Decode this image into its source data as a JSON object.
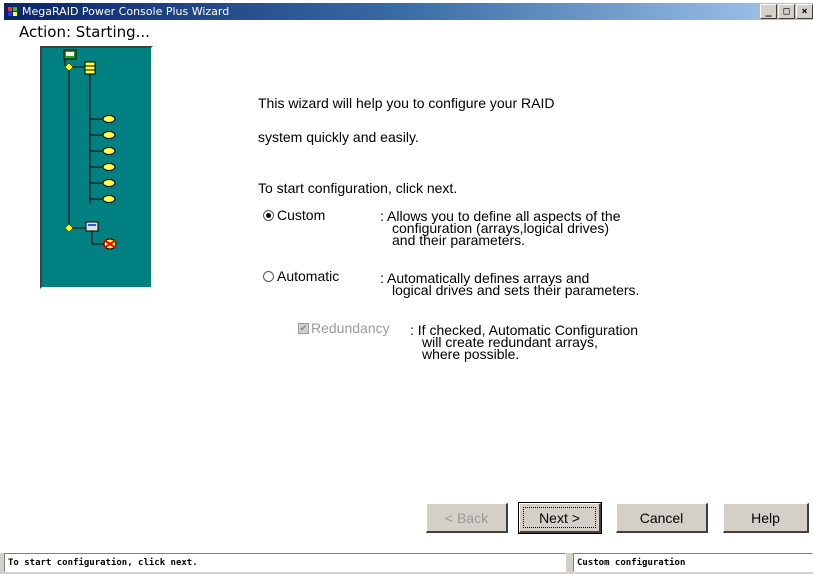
{
  "window": {
    "title": "MegaRAID Power Console Plus Wizard",
    "controls": {
      "minimize": "_",
      "maximize": "□",
      "close": "×"
    }
  },
  "action": {
    "label": "Action: Starting..."
  },
  "intro": {
    "line1": "This wizard will help you to configure your RAID",
    "line2": "system quickly and easily.",
    "start_hint": "To start configuration, click next."
  },
  "options": {
    "custom": {
      "label": "Custom",
      "selected": true,
      "description": [
        ": Allows you to define all aspects of the",
        "configuration (arrays,logical drives)",
        "and their parameters."
      ]
    },
    "automatic": {
      "label": "Automatic",
      "selected": false,
      "description": [
        ": Automatically defines arrays and",
        "logical drives and sets their parameters."
      ]
    },
    "redundancy": {
      "label": "Redundancy",
      "checked": true,
      "enabled": false,
      "description": [
        ": If checked, Automatic Configuration",
        "will create redundant arrays,",
        "where possible."
      ]
    }
  },
  "buttons": {
    "back": "< Back",
    "next": "Next >",
    "cancel": "Cancel",
    "help": "Help"
  },
  "statusbar": {
    "left": "To start configuration, click next.",
    "right": "Custom configuration"
  },
  "colors": {
    "tree_panel": "#008080",
    "titlebar_start": "#0a246a",
    "titlebar_end": "#a6caf0"
  }
}
